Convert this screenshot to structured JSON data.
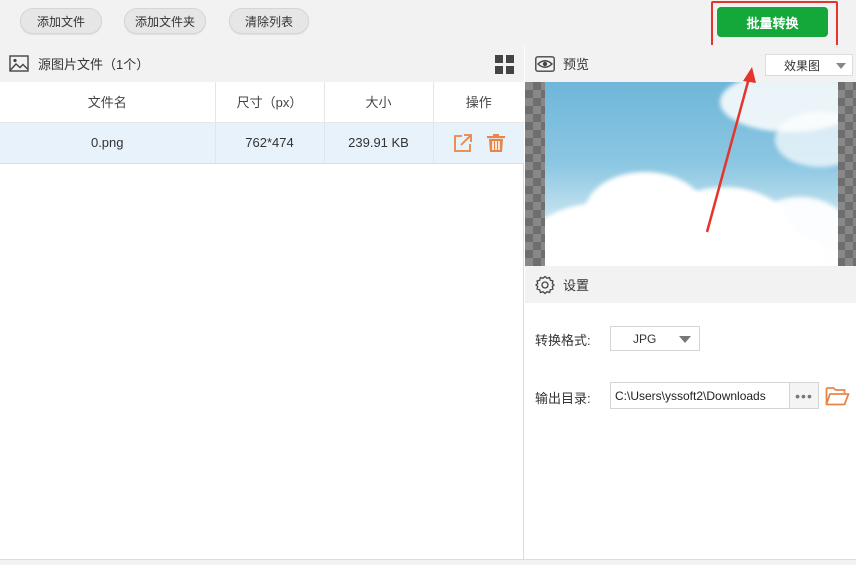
{
  "toolbar": {
    "add_file": "添加文件",
    "add_folder": "添加文件夹",
    "clear_list": "清除列表",
    "batch_convert": "批量转换",
    "accent_color": "#14a83b",
    "highlight_color": "#e5342a"
  },
  "source_panel": {
    "title": "源图片文件（1个）",
    "icon": "image-icon",
    "view_toggle_icon": "grid-icon",
    "columns": [
      "文件名",
      "尺寸（px）",
      "大小",
      "操作"
    ],
    "rows": [
      {
        "name": "0.png",
        "dimensions": "762*474",
        "size": "239.91 KB"
      }
    ],
    "row_action_icons": [
      "open-external-icon",
      "trash-icon"
    ],
    "action_color": "#e8854a"
  },
  "preview": {
    "title": "预览",
    "icon": "eye-icon",
    "mode": "效果图"
  },
  "settings": {
    "title": "设置",
    "icon": "gear-icon",
    "format_label": "转换格式:",
    "format_value": "JPG",
    "output_label": "输出目录:",
    "output_path": "C:\\Users\\yssoft2\\Downloads",
    "browse_dots": "•••",
    "folder_icon": "folder-open-icon"
  }
}
